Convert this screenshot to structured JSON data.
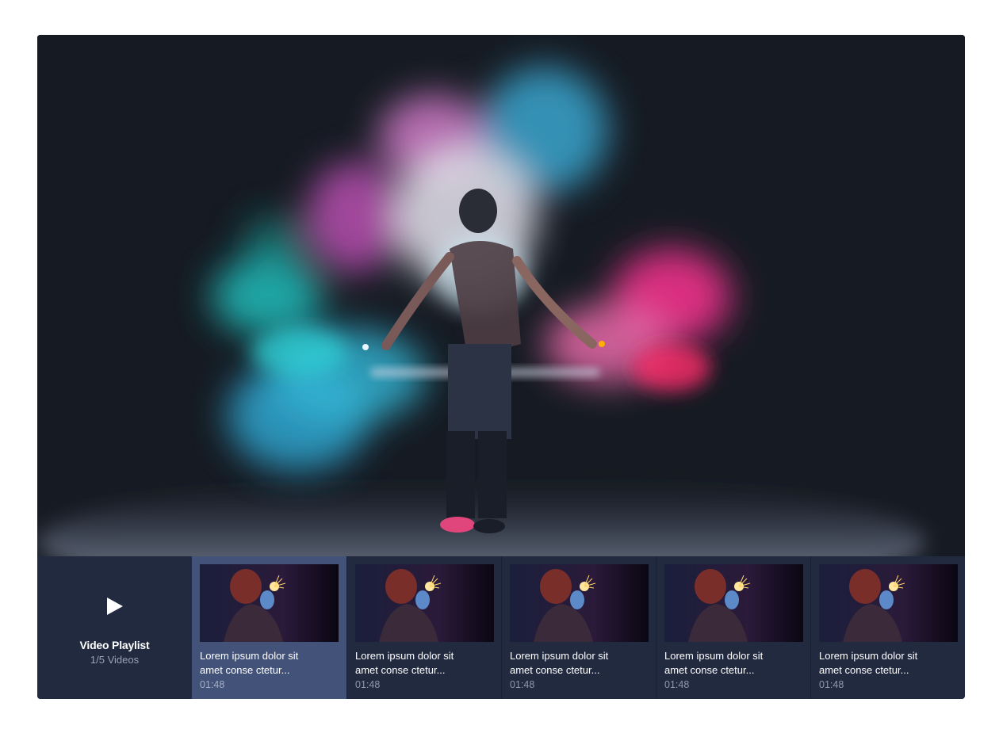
{
  "playlist": {
    "title": "Video Playlist",
    "count": "1/5 Videos",
    "play_icon": "play-icon"
  },
  "colors": {
    "video_bg": "#161b23",
    "bar_bg": "#222a40",
    "active_item_bg": "#435278"
  },
  "items": [
    {
      "title": "Lorem ipsum dolor sit\namet conse ctetur...",
      "duration": "01:48",
      "active": true
    },
    {
      "title": "Lorem ipsum dolor sit\namet conse ctetur...",
      "duration": "01:48",
      "active": false
    },
    {
      "title": "Lorem ipsum dolor sit\namet conse ctetur...",
      "duration": "01:48",
      "active": false
    },
    {
      "title": "Lorem ipsum dolor sit\namet conse ctetur...",
      "duration": "01:48",
      "active": false
    },
    {
      "title": "Lorem ipsum dolor sit\namet conse ctetur...",
      "duration": "01:48",
      "active": false
    }
  ]
}
